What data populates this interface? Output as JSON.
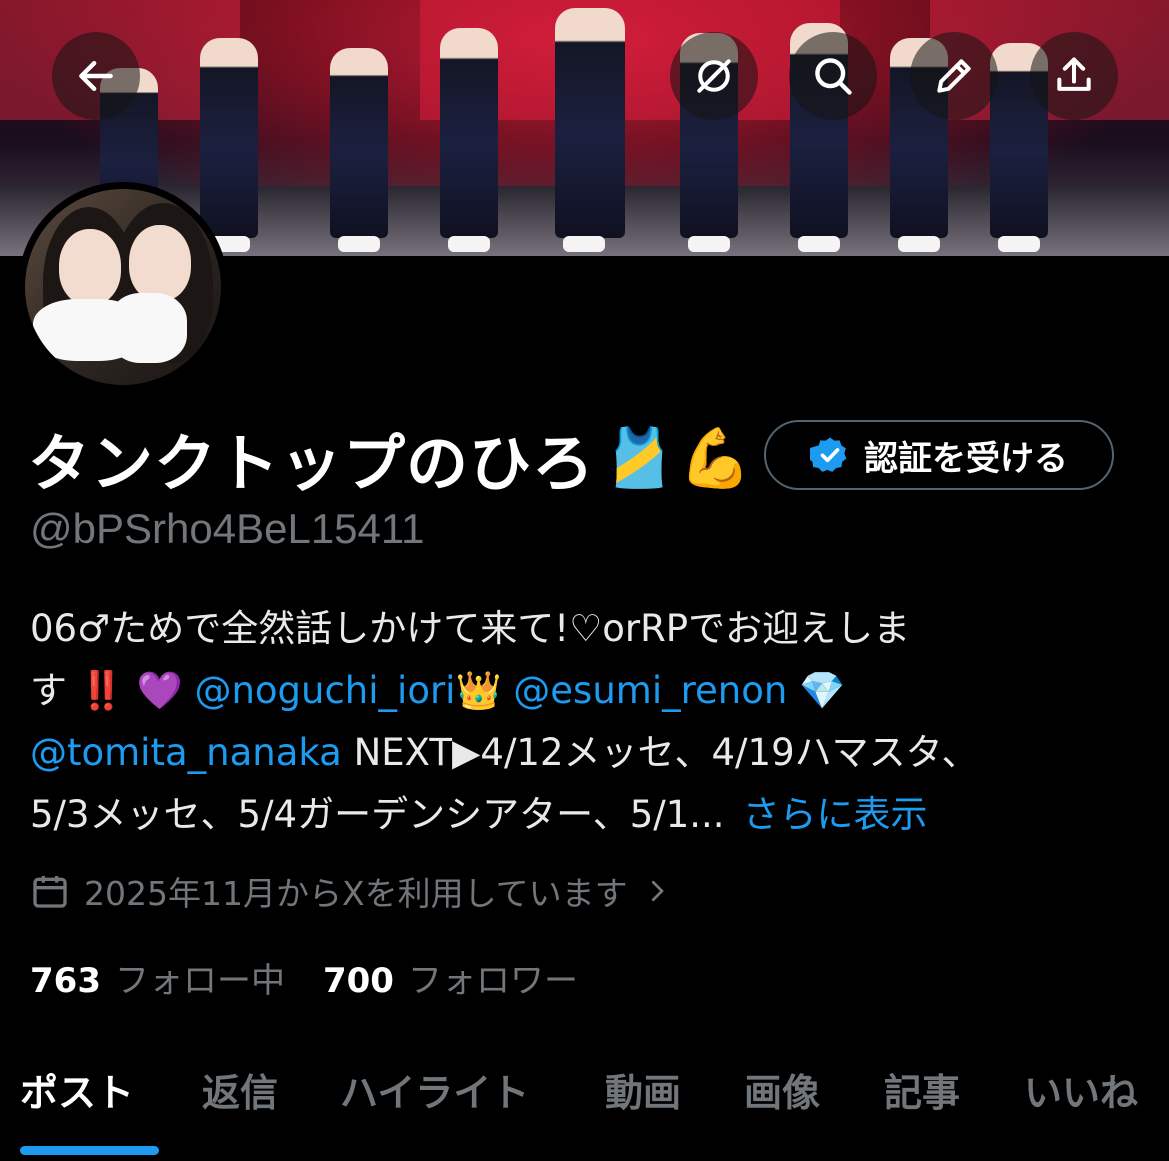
{
  "header": {
    "back_icon": "arrow-left-icon",
    "grok_icon": "grok-icon",
    "search_icon": "search-icon",
    "edit_icon": "pencil-icon",
    "share_icon": "share-icon"
  },
  "profile": {
    "display_name": "タンクトップのひろ",
    "name_emojis": [
      "🎽",
      "💪"
    ],
    "handle": "@bPSrho4BeL15411",
    "verify_button_label": "認証を受ける",
    "bio": {
      "line1": "06♂ためで全然話しかけて来て!♡orRPでお迎えしま",
      "line2_prefix": "す ‼️ 💜 ",
      "mention1": "@noguchi_iori",
      "emoji_crown": "👑",
      "mention2": "@esumi_renon",
      "emoji_gem": " 💎",
      "mention3": "@tomita_nanaka",
      "line3_suffix": " NEXT▶4/12メッセ、4/19ハマスタ、",
      "line4": "5/3メッセ、5/4ガーデンシアター、5/1...",
      "show_more": "さらに表示"
    },
    "joined": "2025年11月からXを利用しています",
    "following_count": "763",
    "following_label": "フォロー中",
    "followers_count": "700",
    "followers_label": "フォロワー"
  },
  "tabs": [
    "ポスト",
    "返信",
    "ハイライト",
    "動画",
    "画像",
    "記事",
    "いいね"
  ],
  "active_tab": "ポスト",
  "colors": {
    "accent": "#1d9bf0",
    "background": "#000000",
    "secondary_text": "#71767b"
  }
}
